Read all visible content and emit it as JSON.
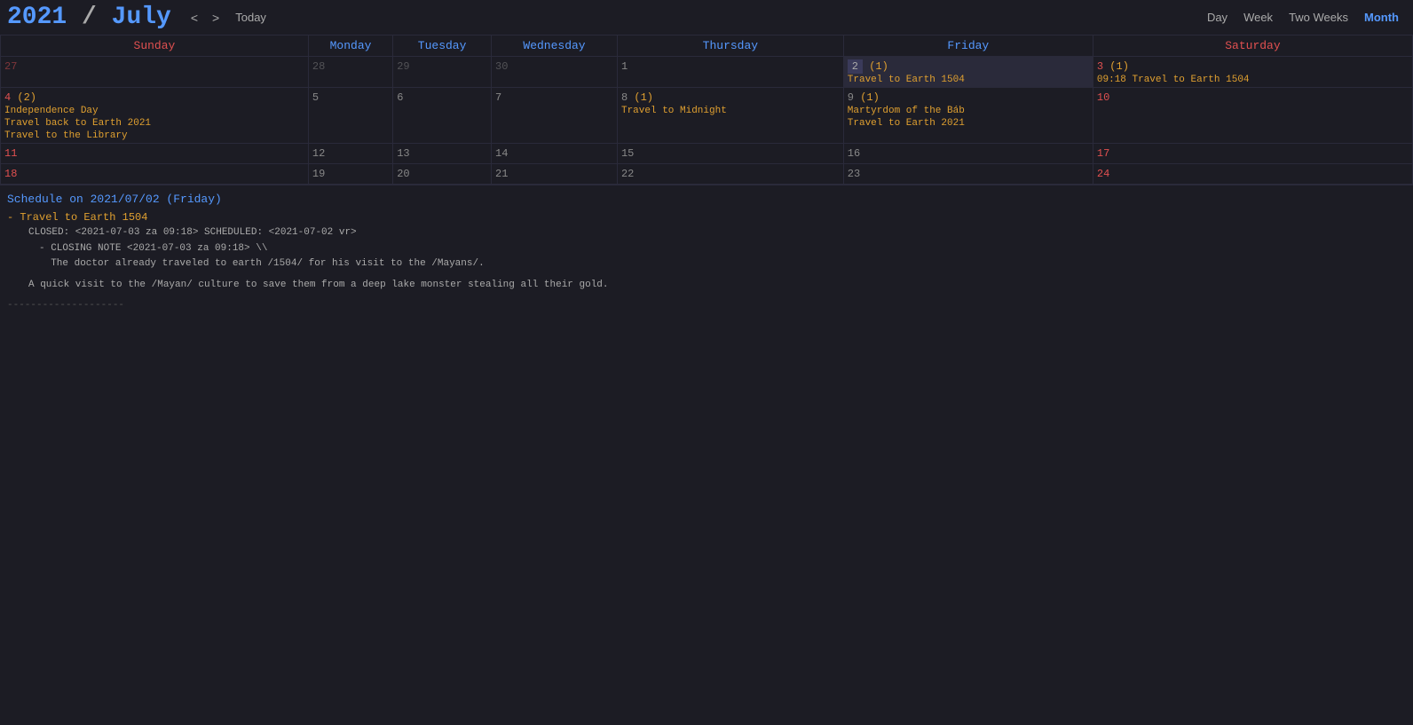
{
  "header": {
    "year": "2021",
    "slash": " / ",
    "month": "July",
    "nav_prev": "<",
    "nav_next": ">",
    "today": "Today",
    "views": [
      "Day",
      "Week",
      "Two Weeks",
      "Month"
    ],
    "active_view": "Month"
  },
  "days_of_week": [
    {
      "label": "Sunday",
      "type": "weekend"
    },
    {
      "label": "Monday",
      "type": "weekday"
    },
    {
      "label": "Tuesday",
      "type": "weekday"
    },
    {
      "label": "Wednesday",
      "type": "weekday"
    },
    {
      "label": "Thursday",
      "type": "weekday"
    },
    {
      "label": "Friday",
      "type": "weekday"
    },
    {
      "label": "Saturday",
      "type": "weekend"
    }
  ],
  "weeks": [
    {
      "days": [
        {
          "num": "27",
          "badi": "",
          "other": true,
          "today": false,
          "weekend": true,
          "events": []
        },
        {
          "num": "28",
          "badi": "",
          "other": true,
          "today": false,
          "weekend": false,
          "events": []
        },
        {
          "num": "29",
          "badi": "",
          "other": true,
          "today": false,
          "weekend": false,
          "events": []
        },
        {
          "num": "30",
          "badi": "",
          "other": true,
          "today": false,
          "weekend": false,
          "events": []
        },
        {
          "num": "1",
          "badi": "",
          "other": false,
          "today": false,
          "weekend": false,
          "events": []
        },
        {
          "num": "2",
          "badi": "(1)",
          "other": false,
          "today": true,
          "weekend": false,
          "events": [
            "Travel to Earth 1504"
          ]
        },
        {
          "num": "3",
          "badi": "(1)",
          "other": false,
          "today": false,
          "weekend": true,
          "events": [
            "09:18 Travel to Earth 1504"
          ]
        }
      ]
    },
    {
      "days": [
        {
          "num": "4",
          "badi": "(2)",
          "other": false,
          "today": false,
          "weekend": true,
          "events": [
            "Independence Day",
            "Travel back to Earth 2021",
            "Travel to the Library"
          ]
        },
        {
          "num": "5",
          "badi": "",
          "other": false,
          "today": false,
          "weekend": false,
          "events": []
        },
        {
          "num": "6",
          "badi": "",
          "other": false,
          "today": false,
          "weekend": false,
          "events": []
        },
        {
          "num": "7",
          "badi": "",
          "other": false,
          "today": false,
          "weekend": false,
          "events": []
        },
        {
          "num": "8",
          "badi": "(1)",
          "other": false,
          "today": false,
          "weekend": false,
          "events": [
            "Travel to Midnight"
          ]
        },
        {
          "num": "9",
          "badi": "(1)",
          "other": false,
          "today": false,
          "weekend": false,
          "events": [
            "Martyrdom of the Báb",
            "Travel to Earth 2021"
          ]
        },
        {
          "num": "10",
          "badi": "",
          "other": false,
          "today": false,
          "weekend": true,
          "events": []
        }
      ]
    },
    {
      "days": [
        {
          "num": "11",
          "badi": "",
          "other": false,
          "today": false,
          "weekend": true,
          "events": []
        },
        {
          "num": "12",
          "badi": "",
          "other": false,
          "today": false,
          "weekend": false,
          "events": []
        },
        {
          "num": "13",
          "badi": "",
          "other": false,
          "today": false,
          "weekend": false,
          "events": []
        },
        {
          "num": "14",
          "badi": "",
          "other": false,
          "today": false,
          "weekend": false,
          "events": []
        },
        {
          "num": "15",
          "badi": "",
          "other": false,
          "today": false,
          "weekend": false,
          "events": []
        },
        {
          "num": "16",
          "badi": "",
          "other": false,
          "today": false,
          "weekend": false,
          "events": []
        },
        {
          "num": "17",
          "badi": "",
          "other": false,
          "today": false,
          "weekend": true,
          "events": []
        }
      ]
    },
    {
      "days": [
        {
          "num": "18",
          "badi": "",
          "other": false,
          "today": false,
          "weekend": true,
          "events": []
        },
        {
          "num": "19",
          "badi": "",
          "other": false,
          "today": false,
          "weekend": false,
          "events": []
        },
        {
          "num": "20",
          "badi": "",
          "other": false,
          "today": false,
          "weekend": false,
          "events": []
        },
        {
          "num": "21",
          "badi": "",
          "other": false,
          "today": false,
          "weekend": false,
          "events": []
        },
        {
          "num": "22",
          "badi": "",
          "other": false,
          "today": false,
          "weekend": false,
          "events": []
        },
        {
          "num": "23",
          "badi": "",
          "other": false,
          "today": false,
          "weekend": false,
          "events": []
        },
        {
          "num": "24",
          "badi": "",
          "other": false,
          "today": false,
          "weekend": true,
          "events": []
        }
      ]
    }
  ],
  "schedule": {
    "title": "Schedule on 2021/07/02 (Friday)",
    "items": [
      {
        "name": "Travel to Earth 1504",
        "meta": "CLOSED: <2021-07-03 za 09:18> SCHEDULED: <2021-07-02 vr>",
        "note_label": "- CLOSING NOTE <2021-07-03 za 09:18> \\\\",
        "note_body": "  The doctor already traveled to earth /1504/ for his visit to the /Mayans/.",
        "desc": "A quick visit to the /Mayan/ culture to save them from a deep lake monster stealing all their gold."
      }
    ],
    "divider": "--------------------"
  }
}
